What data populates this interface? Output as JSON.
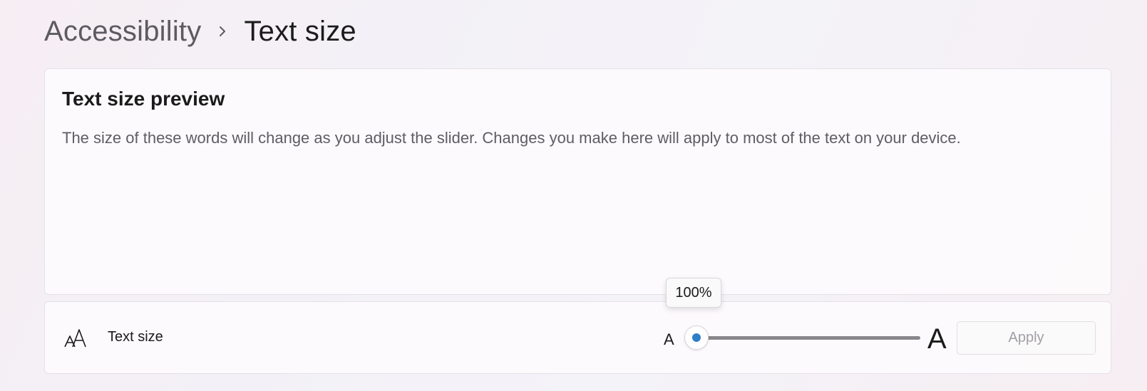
{
  "breadcrumb": {
    "parent": "Accessibility",
    "separator_icon": "chevron-right-icon",
    "current": "Text size"
  },
  "preview": {
    "title": "Text size preview",
    "text": "The size of these words will change as you adjust the slider. Changes you make here will apply to most of the text on your device."
  },
  "text_size_setting": {
    "icon": "text-size-icon",
    "label": "Text size",
    "small_marker": "A",
    "large_marker": "A",
    "slider_value_label": "100%",
    "slider_value_fraction": 0.0,
    "apply_label": "Apply",
    "apply_enabled": false
  },
  "colors": {
    "accent": "#2f7fc7",
    "disabled_text": "#a19ea4"
  }
}
